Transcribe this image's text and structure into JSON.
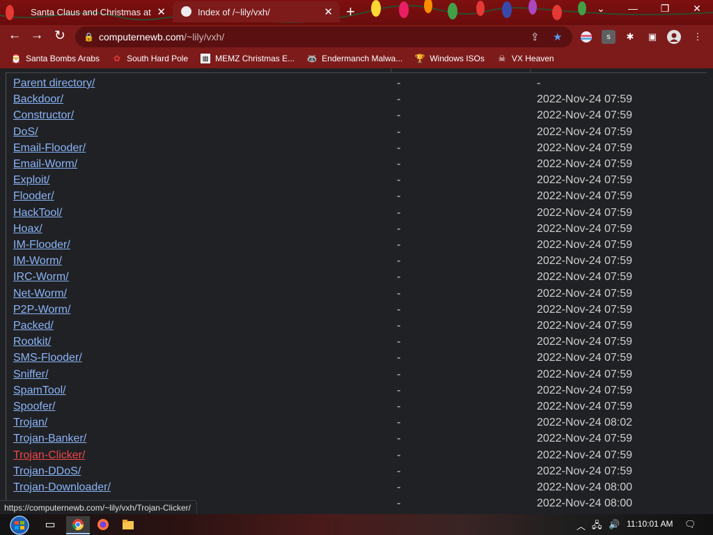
{
  "browser": {
    "tabs": [
      {
        "title": "Santa Claus and Christmas at the",
        "active": false
      },
      {
        "title": "Index of /~lily/vxh/",
        "active": true
      }
    ],
    "url_host": "computernewb.com",
    "url_path": "/~lily/vxh/",
    "bookmarks": [
      {
        "label": "Santa Bombs Arabs",
        "icon": "santa-icon"
      },
      {
        "label": "South Hard Pole",
        "icon": "flower-icon"
      },
      {
        "label": "MEMZ Christmas E...",
        "icon": "image-icon"
      },
      {
        "label": "Endermanch Malwa...",
        "icon": "raccoon-icon"
      },
      {
        "label": "Windows ISOs",
        "icon": "trophy-icon"
      },
      {
        "label": "VX Heaven",
        "icon": "skull-icon"
      }
    ]
  },
  "listing": {
    "rows": [
      {
        "name": "Parent directory/",
        "size": "-",
        "date": "-"
      },
      {
        "name": "Backdoor/",
        "size": "-",
        "date": "2022-Nov-24 07:59"
      },
      {
        "name": "Constructor/",
        "size": "-",
        "date": "2022-Nov-24 07:59"
      },
      {
        "name": "DoS/",
        "size": "-",
        "date": "2022-Nov-24 07:59"
      },
      {
        "name": "Email-Flooder/",
        "size": "-",
        "date": "2022-Nov-24 07:59"
      },
      {
        "name": "Email-Worm/",
        "size": "-",
        "date": "2022-Nov-24 07:59"
      },
      {
        "name": "Exploit/",
        "size": "-",
        "date": "2022-Nov-24 07:59"
      },
      {
        "name": "Flooder/",
        "size": "-",
        "date": "2022-Nov-24 07:59"
      },
      {
        "name": "HackTool/",
        "size": "-",
        "date": "2022-Nov-24 07:59"
      },
      {
        "name": "Hoax/",
        "size": "-",
        "date": "2022-Nov-24 07:59"
      },
      {
        "name": "IM-Flooder/",
        "size": "-",
        "date": "2022-Nov-24 07:59"
      },
      {
        "name": "IM-Worm/",
        "size": "-",
        "date": "2022-Nov-24 07:59"
      },
      {
        "name": "IRC-Worm/",
        "size": "-",
        "date": "2022-Nov-24 07:59"
      },
      {
        "name": "Net-Worm/",
        "size": "-",
        "date": "2022-Nov-24 07:59"
      },
      {
        "name": "P2P-Worm/",
        "size": "-",
        "date": "2022-Nov-24 07:59"
      },
      {
        "name": "Packed/",
        "size": "-",
        "date": "2022-Nov-24 07:59"
      },
      {
        "name": "Rootkit/",
        "size": "-",
        "date": "2022-Nov-24 07:59"
      },
      {
        "name": "SMS-Flooder/",
        "size": "-",
        "date": "2022-Nov-24 07:59"
      },
      {
        "name": "Sniffer/",
        "size": "-",
        "date": "2022-Nov-24 07:59"
      },
      {
        "name": "SpamTool/",
        "size": "-",
        "date": "2022-Nov-24 07:59"
      },
      {
        "name": "Spoofer/",
        "size": "-",
        "date": "2022-Nov-24 07:59"
      },
      {
        "name": "Trojan/",
        "size": "-",
        "date": "2022-Nov-24 08:02"
      },
      {
        "name": "Trojan-Banker/",
        "size": "-",
        "date": "2022-Nov-24 07:59"
      },
      {
        "name": "Trojan-Clicker/",
        "size": "-",
        "date": "2022-Nov-24 07:59",
        "hovered": true
      },
      {
        "name": "Trojan-DDoS/",
        "size": "-",
        "date": "2022-Nov-24 07:59"
      },
      {
        "name": "Trojan-Downloader/",
        "size": "-",
        "date": "2022-Nov-24 08:00"
      },
      {
        "name": "",
        "size": "-",
        "date": "2022-Nov-24 08:00"
      }
    ]
  },
  "status_url": "https://computernewb.com/~lily/vxh/Trojan-Clicker/",
  "taskbar": {
    "clock": "11:10:01 AM"
  },
  "colors": {
    "link": "#8ab4f8",
    "active_link": "#f0474b",
    "chrome_frame": "#7d1b1b",
    "page_bg": "#202124"
  }
}
